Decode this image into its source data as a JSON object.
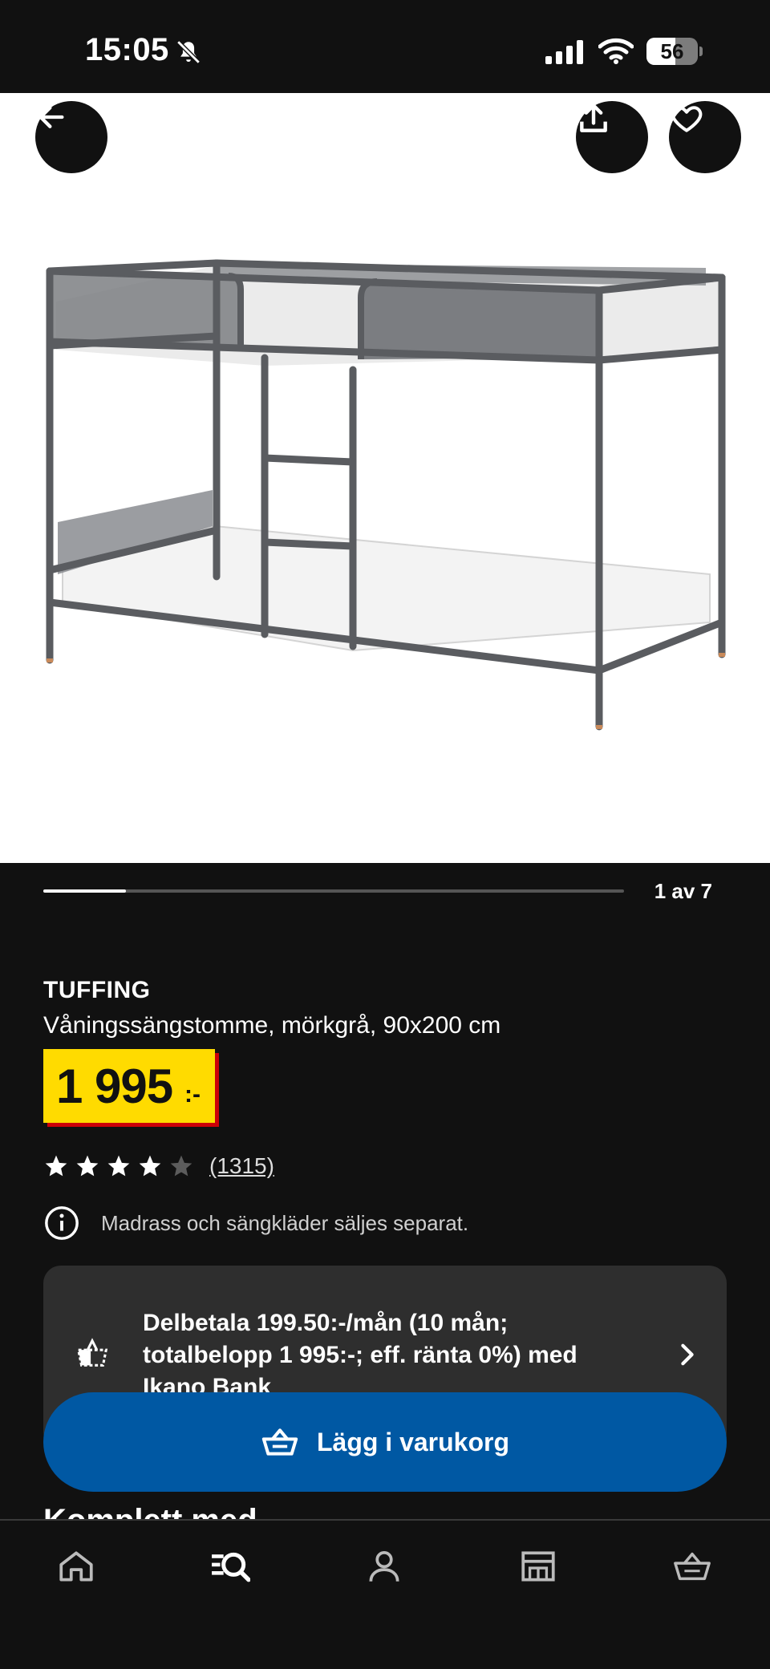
{
  "status_bar": {
    "time": "15:05",
    "battery_level": "56",
    "battery_fraction": 0.56
  },
  "hero": {
    "back_icon": "arrow-left-icon",
    "share_icon": "share-icon",
    "favorite_icon": "heart-icon"
  },
  "gallery": {
    "counter": "1 av 7",
    "current": 1,
    "total": 7
  },
  "product": {
    "name": "TUFFING",
    "description": "Våningssängstomme, mörkgrå, 90x200 cm",
    "price": "1 995",
    "price_suffix": ":-",
    "rating": 4,
    "rating_max": 5,
    "review_count": "(1315)",
    "notice": "Madrass och sängkläder säljes separat."
  },
  "finance": {
    "text": "Delbetala 199.50:-/mån (10 mån; totalbelopp 1 995:-; eff. ränta 0%) med Ikano Bank"
  },
  "cart_button": {
    "label": "Lägg i varukorg"
  },
  "section": {
    "heading": "Komplett med"
  },
  "nav": {
    "items": [
      "home-icon",
      "search-icon",
      "account-icon",
      "store-icon",
      "cart-icon"
    ],
    "active": "search-icon"
  },
  "colors": {
    "background": "#111111",
    "price_yellow": "#ffdb00",
    "price_shadow": "#cc0008",
    "primary_blue": "#0058a3",
    "card_bg": "#2e2e2e"
  }
}
